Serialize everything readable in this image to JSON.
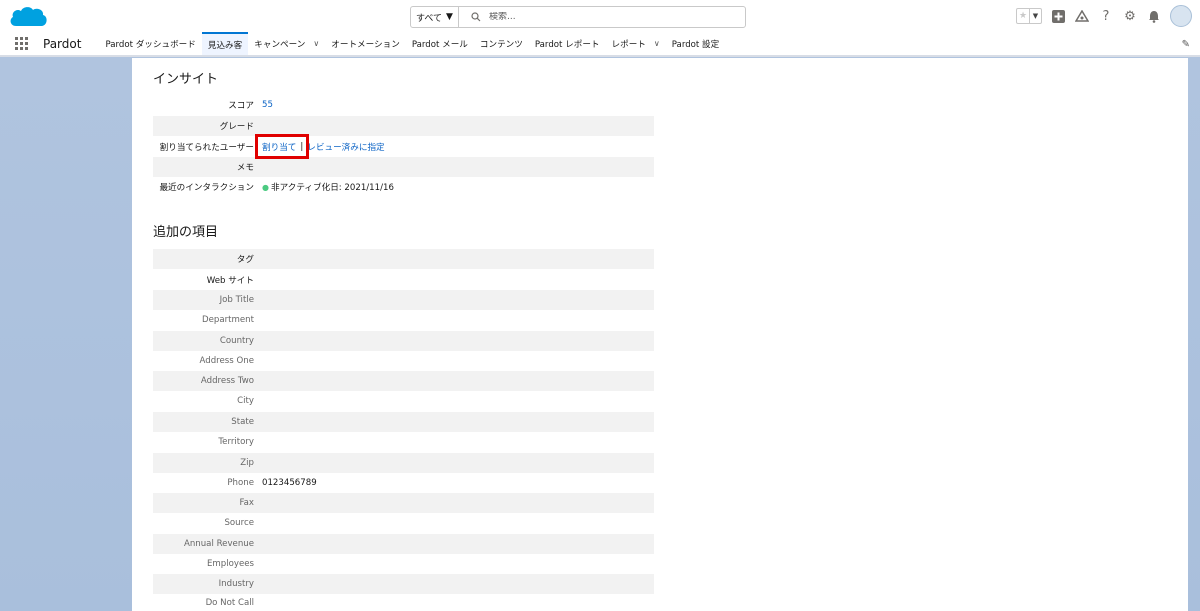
{
  "search": {
    "scope_label": "すべて",
    "placeholder": "検索..."
  },
  "nav": {
    "app_name": "Pardot",
    "tabs": [
      {
        "label": "Pardot ダッシュボード"
      },
      {
        "label": "見込み客"
      },
      {
        "label": "キャンペーン",
        "dropdown": true
      },
      {
        "label": "オートメーション"
      },
      {
        "label": "Pardot メール"
      },
      {
        "label": "コンテンツ"
      },
      {
        "label": "Pardot レポート"
      },
      {
        "label": "レポート",
        "dropdown": true
      },
      {
        "label": "Pardot 設定"
      }
    ],
    "active_tab": "見込み客"
  },
  "insight": {
    "title": "インサイト",
    "score_label": "スコア",
    "score_value": "55",
    "grade_label": "グレード",
    "assigned_label": "割り当てられたユーザー",
    "assign_link": "割り当て",
    "separator": "|",
    "review_link": "レビュー済みに指定",
    "memo_label": "メモ",
    "interaction_label": "最近のインタラクション",
    "interaction_value": "非アクティブ化日: 2021/11/16"
  },
  "additional": {
    "title": "追加の項目",
    "fields": [
      {
        "label": "タグ",
        "value": ""
      },
      {
        "label": "Web サイト",
        "value": ""
      },
      {
        "label": "Job Title",
        "value": ""
      },
      {
        "label": "Department",
        "value": ""
      },
      {
        "label": "Country",
        "value": ""
      },
      {
        "label": "Address One",
        "value": ""
      },
      {
        "label": "Address Two",
        "value": ""
      },
      {
        "label": "City",
        "value": ""
      },
      {
        "label": "State",
        "value": ""
      },
      {
        "label": "Territory",
        "value": ""
      },
      {
        "label": "Zip",
        "value": ""
      },
      {
        "label": "Phone",
        "value": "0123456789"
      },
      {
        "label": "Fax",
        "value": ""
      },
      {
        "label": "Source",
        "value": ""
      },
      {
        "label": "Annual Revenue",
        "value": ""
      },
      {
        "label": "Employees",
        "value": ""
      },
      {
        "label": "Industry",
        "value": ""
      },
      {
        "label": "Do Not Call",
        "value": ""
      }
    ]
  },
  "colors": {
    "brand": "#00a1e0",
    "link": "#0b63c5",
    "highlight": "#e00000",
    "background": "#b0c4df"
  }
}
